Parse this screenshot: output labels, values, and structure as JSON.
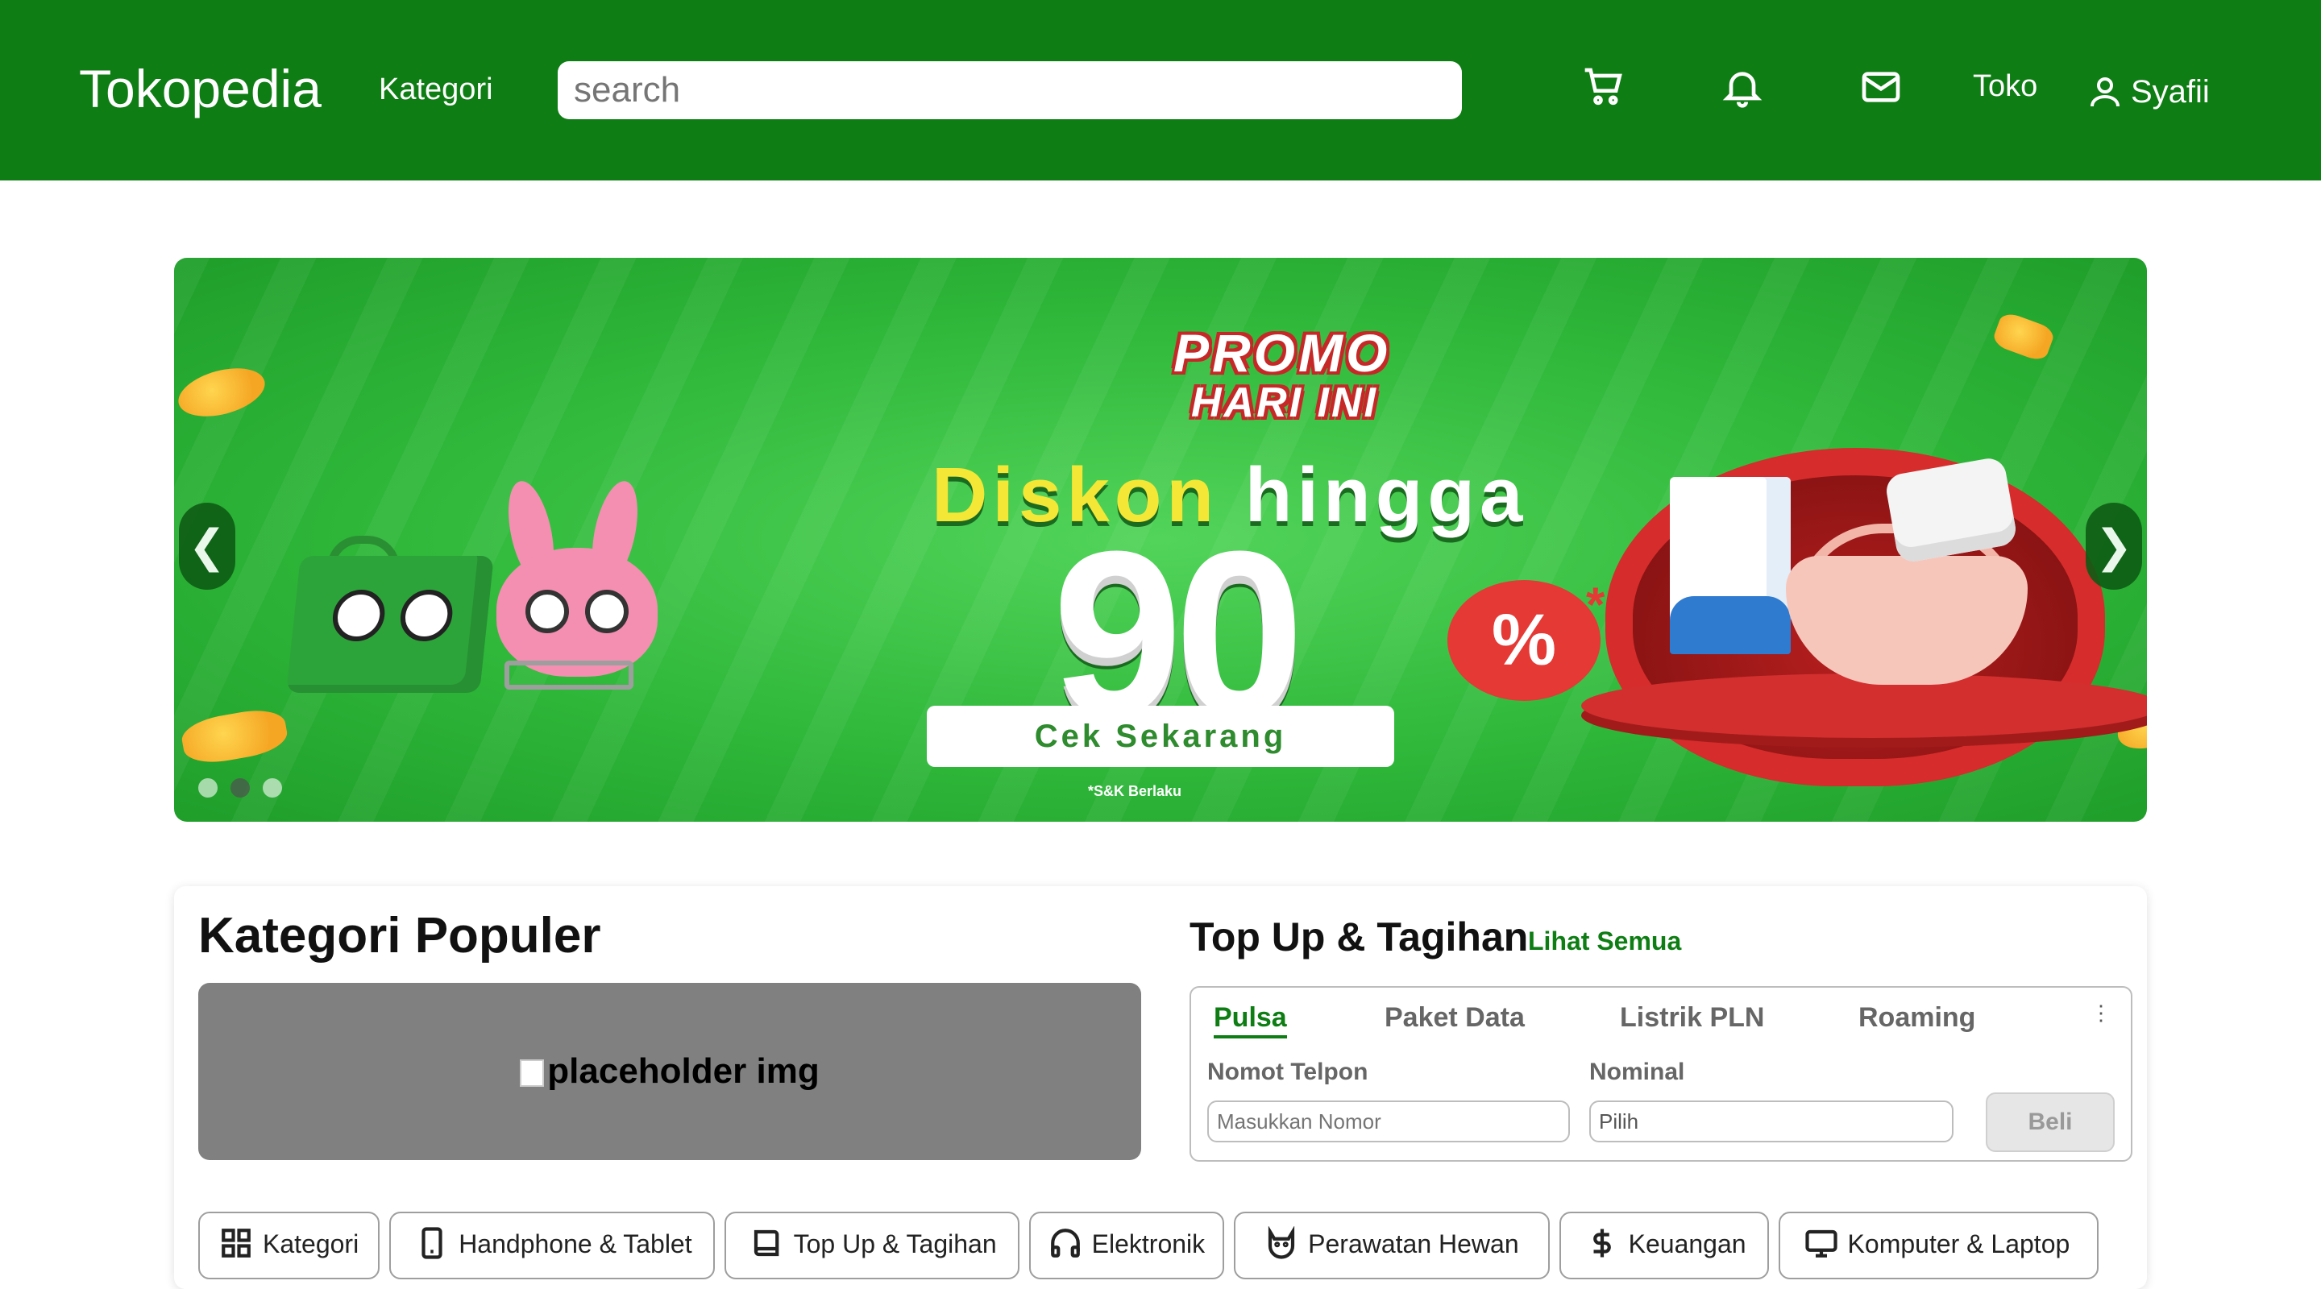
{
  "header": {
    "logo": "Tokopedia",
    "nav_kategori": "Kategori",
    "search_placeholder": "search",
    "icons": [
      "cart-icon",
      "bell-icon",
      "mail-icon",
      "user-icon"
    ],
    "toko_label": "Toko",
    "user_name": "Syafii",
    "bg_color": "#0e7d14"
  },
  "banner": {
    "promo_line1": "PROMO",
    "promo_line2": "HARI INI",
    "headline_a": "Diskon",
    "headline_b": "hingga",
    "big_number": "90",
    "percent_sign": "%",
    "asterisk": "*",
    "cta_label": "Cek Sekarang",
    "terms": "*S&K Berlaku",
    "prev_arrow": "❮",
    "next_arrow": "❯",
    "slides": 3,
    "active_slide": 2
  },
  "kategori_populer": {
    "title": "Kategori Populer",
    "image_alt": "placeholder img"
  },
  "topup": {
    "title": "Top Up & Tagihan",
    "link": "Lihat Semua",
    "tabs": [
      "Pulsa",
      "Paket Data",
      "Listrik PLN",
      "Roaming"
    ],
    "active_tab": "Pulsa",
    "more_icon": "⋮",
    "phone_label": "Nomot Telpon",
    "phone_placeholder": "Masukkan Nomor",
    "nominal_label": "Nominal",
    "nominal_value": "Pilih",
    "buy_label": "Beli"
  },
  "categories": [
    {
      "label": "Kategori",
      "icon": "grid-icon"
    },
    {
      "label": "Handphone & Tablet",
      "icon": "phone-icon"
    },
    {
      "label": "Top Up & Tagihan",
      "icon": "book-icon"
    },
    {
      "label": "Elektronik",
      "icon": "headphones-icon"
    },
    {
      "label": "Perawatan Hewan",
      "icon": "cat-icon"
    },
    {
      "label": "Keuangan",
      "icon": "dollar-icon"
    },
    {
      "label": "Komputer & Laptop",
      "icon": "monitor-icon"
    }
  ]
}
